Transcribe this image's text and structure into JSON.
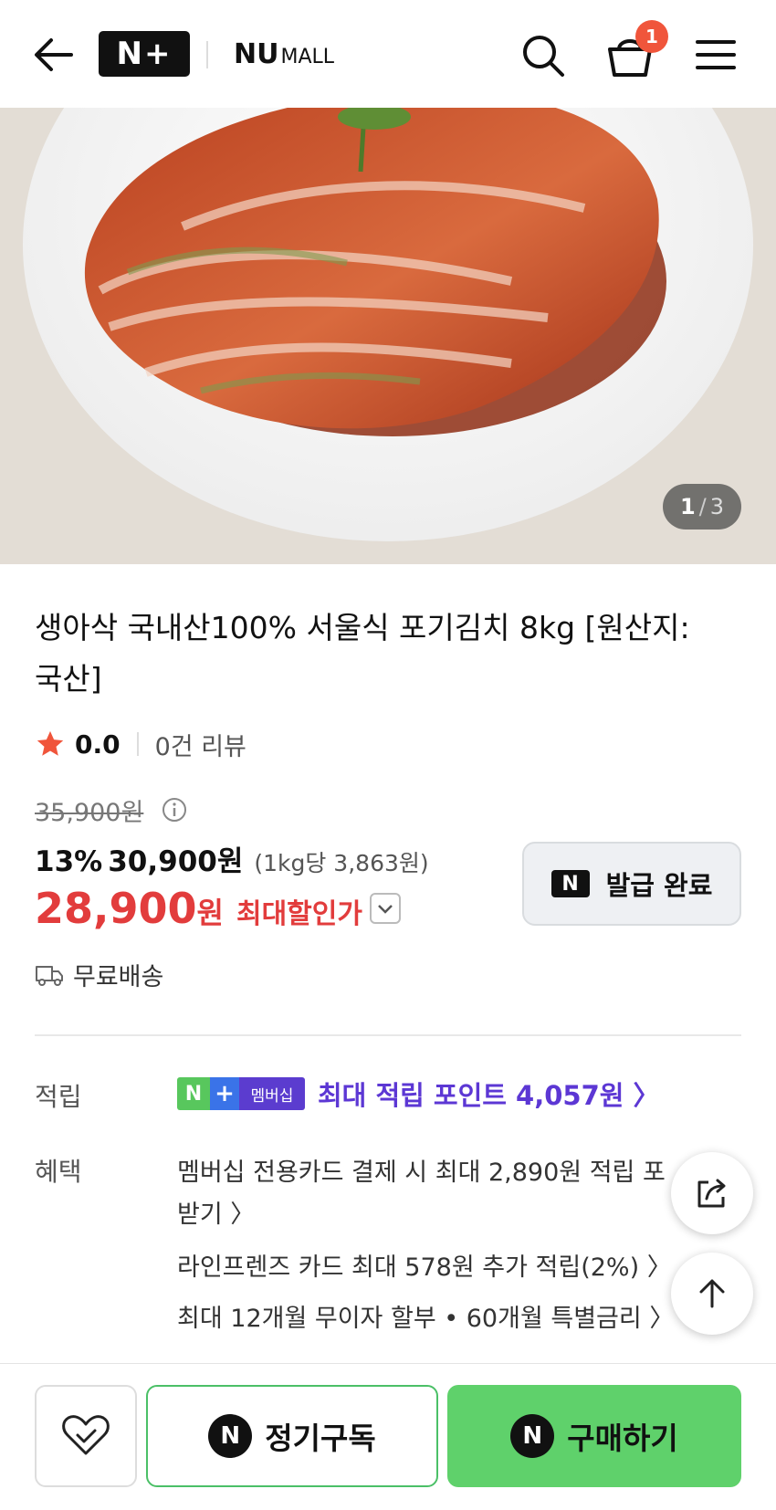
{
  "header": {
    "logo_np": "N+",
    "logo_nu": "NU",
    "logo_mall": "MALL",
    "cart_count": "1"
  },
  "gallery": {
    "current": "1",
    "separator": "/",
    "total": "3"
  },
  "product": {
    "title_line1": "생아삭 국내산100% 서울식 포기김치 8kg [원산지:",
    "title_line2": "국산]",
    "rating": "0.0",
    "reviews": "0건 리뷰",
    "original_price": "35,900원",
    "discount_pct": "13%",
    "discount_price": "30,900원",
    "unit_price": "(1kg당 3,863원)",
    "final_price": "28,900",
    "final_won": "원",
    "final_label": "최대할인가",
    "coupon_label": "발급 완료",
    "coupon_badge": "N",
    "shipping": "무료배송"
  },
  "benefits": {
    "points_label": "적립",
    "membership_n": "N",
    "membership_plus": "+",
    "membership_text": "멤버십",
    "points_text": "최대 적립 포인트 4,057원 〉",
    "benefit_label": "혜택",
    "line1": "멤버십 전용카드 결제 시 최대 2,890원 적립 포",
    "line2": "받기 〉",
    "line3": "라인프렌즈 카드 최대 578원 추가 적립(2%) 〉",
    "line4": "최대 12개월 무이자 할부 • 60개월 특별금리 〉"
  },
  "bottom": {
    "subscribe": "정기구독",
    "buy": "구매하기",
    "n_icon": "N"
  },
  "colors": {
    "accent_red": "#e23c3c",
    "buy_green": "#5fd16b",
    "membership_purple": "#5c37d4",
    "badge": "#f0553b"
  },
  "icons": [
    "back-arrow-icon",
    "search-icon",
    "cart-icon",
    "menu-icon",
    "star-icon",
    "info-icon",
    "chevron-down-icon",
    "truck-icon",
    "share-icon",
    "arrow-up-icon",
    "heart-check-icon"
  ]
}
